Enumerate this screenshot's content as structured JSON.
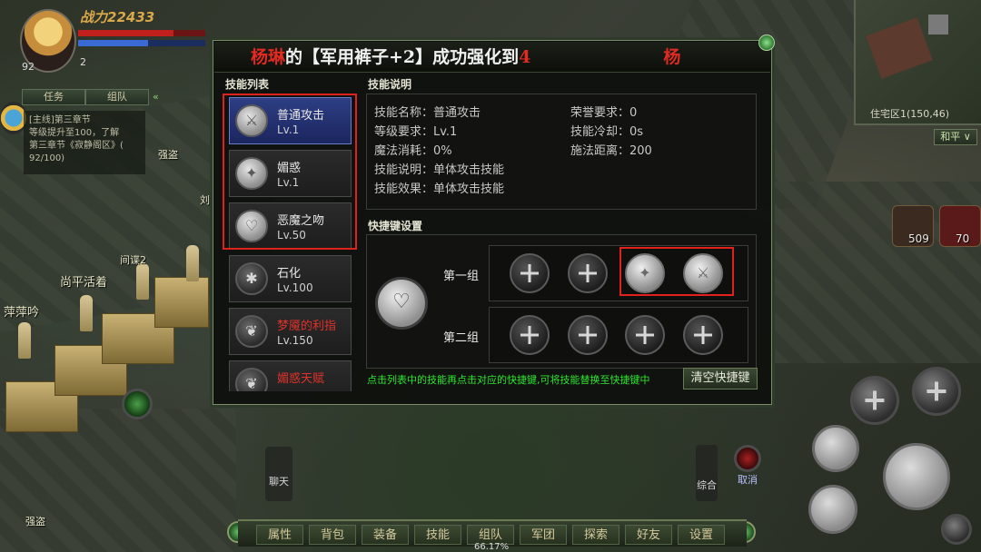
{
  "hud": {
    "power_label": "战力",
    "power_value": "22433",
    "player_level": "92",
    "stage_suffix": "2",
    "tabs": [
      "任务",
      "组队"
    ],
    "quest_lines": [
      "[主线]第三章节",
      "等级提升至100，了解",
      "第三章节《寂静阁区》(",
      "92/100)"
    ],
    "hp_fraction": 0.75,
    "mp_fraction": 0.55
  },
  "minimap": {
    "location": "住宅区1(150,46)",
    "mode": "和平"
  },
  "consumables": [
    {
      "icon": "food-bowl-icon",
      "count": "509"
    },
    {
      "icon": "soda-can-icon",
      "count": "70"
    }
  ],
  "world_labels": [
    "强盗",
    "尚平活着",
    "萍萍吟",
    "间谍2",
    "强盗",
    "刘"
  ],
  "banner": {
    "name": "杨琳",
    "middle1": "的【军用裤子+2】成功强化到",
    "level": "4",
    "trailing": "杨"
  },
  "skill_panel": {
    "list_title": "技能列表",
    "desc_title": "技能说明",
    "hotkey_title": "快捷键设置",
    "skills": [
      {
        "name": "普通攻击",
        "lv": "Lv.1",
        "icon": "sword-icon",
        "name_color": "normal"
      },
      {
        "name": "媚惑",
        "lv": "Lv.1",
        "icon": "sparkle-icon",
        "name_color": "normal"
      },
      {
        "name": "恶魔之吻",
        "lv": "Lv.50",
        "icon": "heart-icon",
        "name_color": "normal"
      },
      {
        "name": "石化",
        "lv": "Lv.100",
        "icon": "stone-icon",
        "name_color": "normal"
      },
      {
        "name": "梦魇的利指",
        "lv": "Lv.150",
        "icon": "claw-icon",
        "name_color": "red"
      },
      {
        "name": "媚惑天赋",
        "lv": "",
        "icon": "talent-icon",
        "name_color": "red"
      }
    ],
    "desc": {
      "name": "技能名称：普通攻击",
      "level_req": "等级要求：Lv.1",
      "mp_cost": "魔法消耗：0%",
      "desc": "技能说明：单体攻击技能",
      "effect": "技能效果：单体攻击技能",
      "honor": "荣誉要求：0",
      "cooldown": "技能冷却：0s",
      "range": "施法距离：200"
    },
    "groups": [
      "第一组",
      "第二组"
    ],
    "hint": "点击列表中的技能再点击对应的快捷键,可将技能替换至快捷键中",
    "clear_button": "清空快捷键"
  },
  "bottom": {
    "chat": "聊天",
    "combine": "综合",
    "cancel": "取消",
    "menu": [
      "属性",
      "背包",
      "装备",
      "技能",
      "组队",
      "军团",
      "探索",
      "好友",
      "设置"
    ],
    "exp_percent": "66.17%"
  },
  "colors": {
    "accent_red": "#e0221c",
    "hint_green": "#2ee62e",
    "selected_blue": "#2d3e83"
  }
}
